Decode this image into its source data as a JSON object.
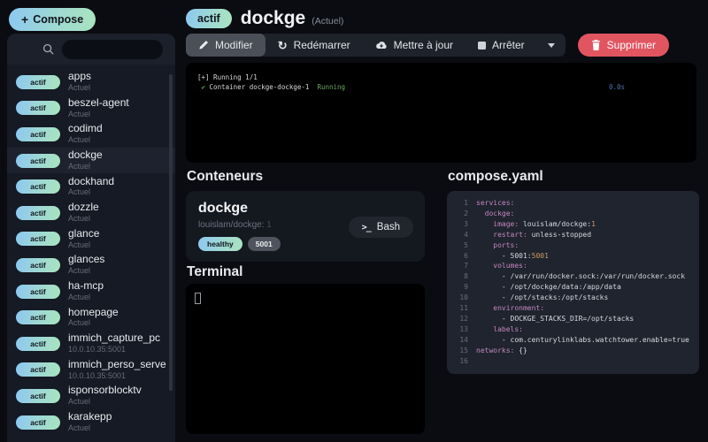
{
  "colors": {
    "gradient_start": "#8cc8f1",
    "gradient_end": "#a9e4bf",
    "danger": "#e15561",
    "yaml_key": "#c586c0",
    "yaml_number": "#d19a66",
    "terminal_green": "#6ca761",
    "terminal_blue": "#4f74ae"
  },
  "compose_button": {
    "label": "Compose",
    "plus": "+"
  },
  "sidebar": {
    "search_placeholder": "",
    "badge_label": "actif",
    "selected": "dockge",
    "items": [
      {
        "name": "apps",
        "subtitle": "Actuel"
      },
      {
        "name": "beszel-agent",
        "subtitle": "Actuel"
      },
      {
        "name": "codimd",
        "subtitle": "Actuel"
      },
      {
        "name": "dockge",
        "subtitle": "Actuel"
      },
      {
        "name": "dockhand",
        "subtitle": "Actuel"
      },
      {
        "name": "dozzle",
        "subtitle": "Actuel"
      },
      {
        "name": "glance",
        "subtitle": "Actuel"
      },
      {
        "name": "glances",
        "subtitle": "Actuel"
      },
      {
        "name": "ha-mcp",
        "subtitle": "Actuel"
      },
      {
        "name": "homepage",
        "subtitle": "Actuel"
      },
      {
        "name": "immich_capture_pc",
        "subtitle": "10.0.10.35:5001"
      },
      {
        "name": "immich_perso_server",
        "subtitle": "10.0.10.35:5001"
      },
      {
        "name": "isponsorblocktv",
        "subtitle": "Actuel"
      },
      {
        "name": "karakepp",
        "subtitle": "Actuel"
      }
    ]
  },
  "header": {
    "badge": "actif",
    "title": "dockge",
    "suffix": "(Actuel)"
  },
  "toolbar": {
    "edit": "Modifier",
    "restart": "Redémarrer",
    "update": "Mettre à jour",
    "stop": "Arrêter",
    "delete": "Supprimer"
  },
  "progress_terminal": {
    "line1": "[+] Running 1/1",
    "check": " ✔ ",
    "container": "Container dockge-dockge-1",
    "status": "Running",
    "time": "0.0s"
  },
  "containers": {
    "heading": "Conteneurs",
    "card": {
      "name": "dockge",
      "image": "louislam/dockge:",
      "tag": "1",
      "status_badge": "healthy",
      "port_badge": "5001",
      "bash_label": "Bash",
      "bash_icon": ">_"
    }
  },
  "terminal": {
    "heading": "Terminal"
  },
  "editor": {
    "heading": "compose.yaml",
    "lines": [
      {
        "n": "1",
        "parts": [
          {
            "t": "services:",
            "c": "key"
          }
        ]
      },
      {
        "n": "2",
        "parts": [
          {
            "t": "  "
          },
          {
            "t": "dockge:",
            "c": "key"
          }
        ]
      },
      {
        "n": "3",
        "parts": [
          {
            "t": "    "
          },
          {
            "t": "image:",
            "c": "key"
          },
          {
            "t": " louislam/dockge:"
          },
          {
            "t": "1",
            "c": "num"
          }
        ]
      },
      {
        "n": "4",
        "parts": [
          {
            "t": "    "
          },
          {
            "t": "restart:",
            "c": "key"
          },
          {
            "t": " unless-stopped"
          }
        ]
      },
      {
        "n": "5",
        "parts": [
          {
            "t": "    "
          },
          {
            "t": "ports:",
            "c": "key"
          }
        ]
      },
      {
        "n": "6",
        "parts": [
          {
            "t": "      - 5001:"
          },
          {
            "t": "5001",
            "c": "num"
          }
        ]
      },
      {
        "n": "7",
        "parts": [
          {
            "t": "    "
          },
          {
            "t": "volumes:",
            "c": "key"
          }
        ]
      },
      {
        "n": "8",
        "parts": [
          {
            "t": "      - /var/run/docker.sock:/var/run/docker.sock"
          }
        ]
      },
      {
        "n": "9",
        "parts": [
          {
            "t": "      - /opt/dockge/data:/app/data"
          }
        ]
      },
      {
        "n": "10",
        "parts": [
          {
            "t": "      - /opt/stacks:/opt/stacks"
          }
        ]
      },
      {
        "n": "11",
        "parts": [
          {
            "t": "    "
          },
          {
            "t": "environment:",
            "c": "key"
          }
        ]
      },
      {
        "n": "12",
        "parts": [
          {
            "t": "      - DOCKGE_STACKS_DIR=/opt/stacks"
          }
        ]
      },
      {
        "n": "13",
        "parts": [
          {
            "t": "    "
          },
          {
            "t": "labels:",
            "c": "key"
          }
        ]
      },
      {
        "n": "14",
        "parts": [
          {
            "t": "      - com.centurylinklabs.watchtower.enable=true"
          }
        ]
      },
      {
        "n": "15",
        "parts": [
          {
            "t": "networks:",
            "c": "key"
          },
          {
            "t": " {}"
          }
        ]
      },
      {
        "n": "16",
        "parts": []
      }
    ]
  }
}
